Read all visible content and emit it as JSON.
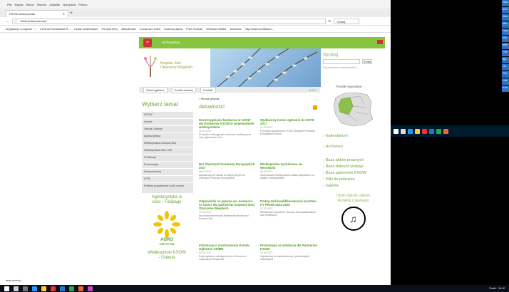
{
  "browser": {
    "menu": [
      "Plik",
      "Edycja",
      "Widok",
      "Historia",
      "Zakładki",
      "Narzędzia",
      "Pomoc"
    ],
    "tab_title": "KSOW wielkopolska",
    "url": "wielkopolska.ksow.pl",
    "search_placeholder": "Szukaj",
    "bookmarks": [
      "Wyjątkowy i program \"...",
      "Centrum Doradztwa R...",
      "Część odwiedzane",
      "Pomysł firmy",
      "Aktualności",
      "Customize Links",
      "Dostosuj łącza",
      "Free Hotmail",
      "Windows Media",
      "Windows",
      "http://www.portalsam..."
    ],
    "status": "www.umww.pl"
  },
  "site": {
    "hero_title": [
      "Krajowa Sieć",
      "Obszarów Wiejskich"
    ],
    "top_name": "wielkopolska",
    "nav": [
      "Strona główna",
      "Portal rankowy",
      "Kontakt"
    ],
    "font_ctrl": "A A A",
    "left_heading": "Wybierz temat",
    "menu": [
      "KSOW",
      "Leader",
      "Szkoła Liderów",
      "Agroturystyka",
      "Wielkopolska Odnowa Wsi",
      "Wielkopolska Sieć LSD",
      "Publikacje",
      "Prezentacje",
      "Sprawozdania",
      "LPIS",
      "Polityka prywatności i pliki cookie"
    ],
    "agro_title": [
      "Agroturystyka w",
      "sieci - Fanpage"
    ],
    "agro_logo": [
      "AGRO",
      "TURYSTYKA"
    ],
    "ksow_gal": [
      "Wielkopolski KSOW",
      "- Galeria"
    ],
    "breadcrumb": "Strona główna",
    "section": "Aktualności",
    "news": [
      {
        "title": "Rozstrzygnięcie konkursu nr 1/2017 dla Partnerów KSOW w województwie wielkopolskim",
        "date": "23.03.2017",
        "text": "W wyniku rozstrzygnięcia konkursu i analizy przez oraz zgłoszonych ofert"
      },
      {
        "title": "Wydłużony termin zgłoszeń do DOFE 2017",
        "date": "21.03.2017",
        "text": "Formularz zgłoszeniowy do Dni Otwartych Funduszy Europejskich można"
      },
      {
        "title": "Dni Otwartych Funduszy Europejskich 2017",
        "date": "08.03.2017",
        "text": "Zapraszamy do udziału w kolejnej edycji Dni Otwartych Funduszy Europejskich"
      },
      {
        "title": "Wielkopolska wyróżniona we Wrocławiu",
        "date": "08.03.2017",
        "text": "Województwo Wielkopolskie zostało nagrodzone na targach Wielkopolskich"
      },
      {
        "title": "Odpowiedzi na pytania ws. konkursu nr 1/2017 dla partnerów Krajowej Sieci Obszarów Wiejskich",
        "date": "17.02.2017",
        "text": "Na stronie internetowej Ministerstwa Rolnictwa i Rozwoju Wsi"
      },
      {
        "title": "Podręcznik kwalifikowalności kosztów PT PROW 2014-2020",
        "date": "07.02.2017",
        "text": "Ministerstwo Rolnictwa i Rozwoju Wsi opublikowało w dniu dzisiejszym"
      },
      {
        "title": "Informacje o uruchomieniu Portalu Ogłoszeń ARiMR",
        "date": "03.02.2017",
        "text": "Portal ogłoszeń udostępniony do 10 marca br. rozpoczęcie 28 stycznia"
      },
      {
        "title": "Prezentacje ze szkolenia dla Partnerów KSOW",
        "date": "03.02.2017",
        "text": "Zapraszamy do zapoznania się z prezentacjami dotyczącymi"
      }
    ],
    "search_title": "Szukaj",
    "search_btn": "Szukaj",
    "search_adv": "Wyszukiwanie zaawansowane",
    "portals": "Portale regionalne",
    "right_links": [
      "Kalendarium",
      "Archiwum",
      "Baza aktów prawnych",
      "Baza dobrych praktyk",
      "Baza partnerów KSOW",
      "Pliki do pobrania",
      "Galeria"
    ],
    "hymn": [
      "Hymn Szkoły Liderek",
      "Rozwoju Lokalnego"
    ]
  },
  "side_panel": [
    "Nad",
    "Info",
    "Wie",
    "Mie",
    "Leg",
    "Wo",
    "Inte",
    "Pra",
    "apl",
    "Lin",
    "PO",
    "Lok",
    "Kon"
  ],
  "clock": "Polski ^ 15:42",
  "colors": {
    "green": "#86c440",
    "link": "#6ba530"
  }
}
